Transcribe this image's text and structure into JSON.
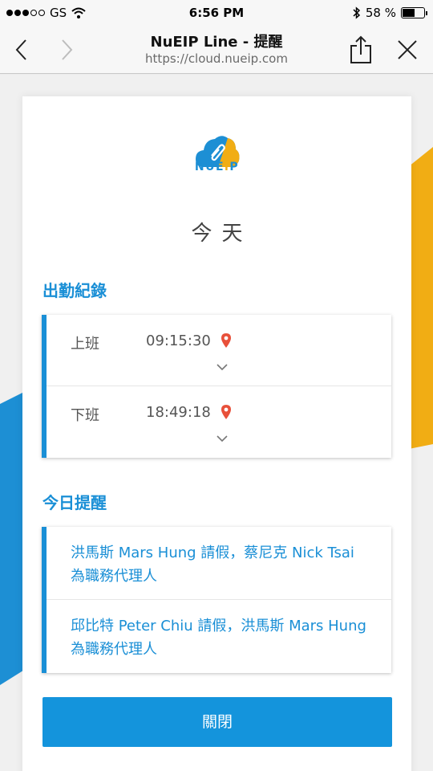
{
  "status_bar": {
    "carrier": "GS",
    "time": "6:56 PM",
    "battery_percent": "58 %",
    "battery_level": 0.58
  },
  "browser": {
    "title": "NuEIP Line - 提醒",
    "url": "https://cloud.nueip.com"
  },
  "logo": {
    "text": "NUEiP"
  },
  "page": {
    "heading": "今天"
  },
  "attendance": {
    "title": "出勤紀錄",
    "records": [
      {
        "label": "上班",
        "time": "09:15:30"
      },
      {
        "label": "下班",
        "time": "18:49:18"
      }
    ]
  },
  "reminders": {
    "title": "今日提醒",
    "items": [
      {
        "text": "洪馬斯 Mars Hung 請假，蔡尼克 Nick Tsai 為職務代理人"
      },
      {
        "text": "邱比特 Peter Chiu 請假，洪馬斯 Mars Hung 為職務代理人"
      }
    ]
  },
  "actions": {
    "close_label": "關閉"
  },
  "colors": {
    "accent": "#1a8fd6",
    "button": "#1494dc",
    "decor_yellow": "#f1ad14",
    "decor_blue": "#1d8fd4",
    "pin_red": "#e8503a"
  }
}
